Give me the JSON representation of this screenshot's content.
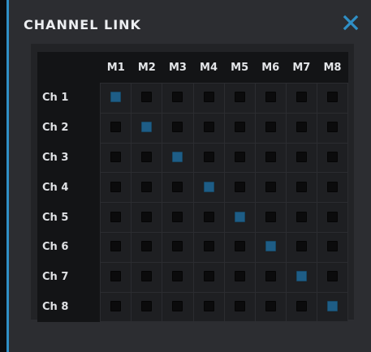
{
  "title": "CHANNEL LINK",
  "colors": {
    "accent": "#2f8fc6",
    "linked": "#1e5d86",
    "unlinked": "#0b0b0c"
  },
  "close_icon": "close-icon",
  "columns": [
    "M1",
    "M2",
    "M3",
    "M4",
    "M5",
    "M6",
    "M7",
    "M8"
  ],
  "rows": [
    {
      "label": "Ch 1",
      "links": [
        true,
        false,
        false,
        false,
        false,
        false,
        false,
        false
      ]
    },
    {
      "label": "Ch 2",
      "links": [
        false,
        true,
        false,
        false,
        false,
        false,
        false,
        false
      ]
    },
    {
      "label": "Ch 3",
      "links": [
        false,
        false,
        true,
        false,
        false,
        false,
        false,
        false
      ]
    },
    {
      "label": "Ch 4",
      "links": [
        false,
        false,
        false,
        true,
        false,
        false,
        false,
        false
      ]
    },
    {
      "label": "Ch 5",
      "links": [
        false,
        false,
        false,
        false,
        true,
        false,
        false,
        false
      ]
    },
    {
      "label": "Ch 6",
      "links": [
        false,
        false,
        false,
        false,
        false,
        true,
        false,
        false
      ]
    },
    {
      "label": "Ch 7",
      "links": [
        false,
        false,
        false,
        false,
        false,
        false,
        true,
        false
      ]
    },
    {
      "label": "Ch 8",
      "links": [
        false,
        false,
        false,
        false,
        false,
        false,
        false,
        true
      ]
    }
  ]
}
